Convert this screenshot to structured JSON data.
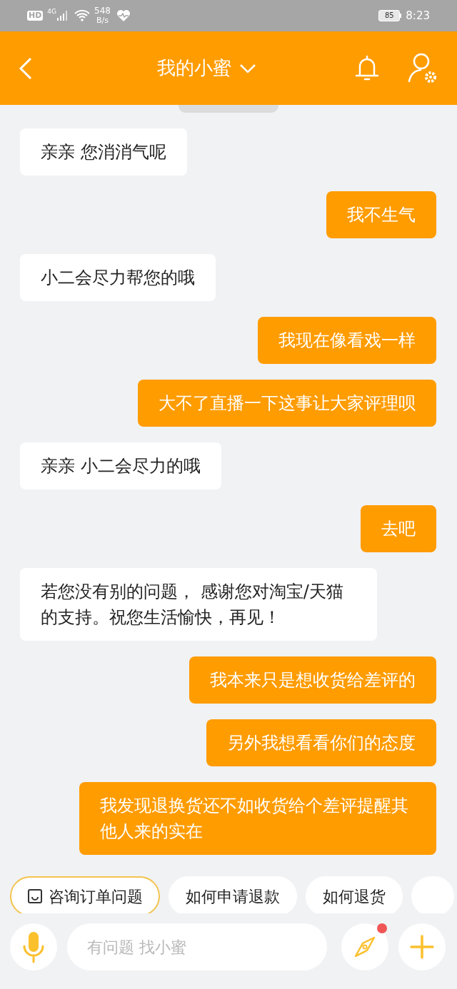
{
  "status_bar": {
    "hd": "HD",
    "network": "4G",
    "speed": "548",
    "speed_unit": "B/s",
    "battery": "85",
    "time": "8:23"
  },
  "header": {
    "title": "我的小蜜"
  },
  "messages": [
    {
      "kind": "received",
      "text": "亲亲 您消消气呢"
    },
    {
      "kind": "sent",
      "text": "我不生气"
    },
    {
      "kind": "received",
      "text": "小二会尽力帮您的哦"
    },
    {
      "kind": "sent",
      "text": "我现在像看戏一样"
    },
    {
      "kind": "sent",
      "text": "大不了直播一下这事让大家评理呗"
    },
    {
      "kind": "received",
      "text": "亲亲 小二会尽力的哦"
    },
    {
      "kind": "sent",
      "text": "去吧"
    },
    {
      "kind": "received",
      "text": "若您没有别的问题， 感谢您对淘宝/天猫的支持。祝您生活愉快，再见！"
    },
    {
      "kind": "sent",
      "text": "我本来只是想收货给差评的"
    },
    {
      "kind": "sent",
      "text": "另外我想看看你们的态度"
    },
    {
      "kind": "sent",
      "text": "我发现退换货还不如收货给个差评提醒其他人来的实在"
    }
  ],
  "quick_replies": [
    {
      "label": "咨询订单问题",
      "selected": true
    },
    {
      "label": "如何申请退款",
      "selected": false
    },
    {
      "label": "如何退货",
      "selected": false
    }
  ],
  "input": {
    "placeholder": "有问题 找小蜜"
  },
  "discover": {
    "has_notification": true
  }
}
